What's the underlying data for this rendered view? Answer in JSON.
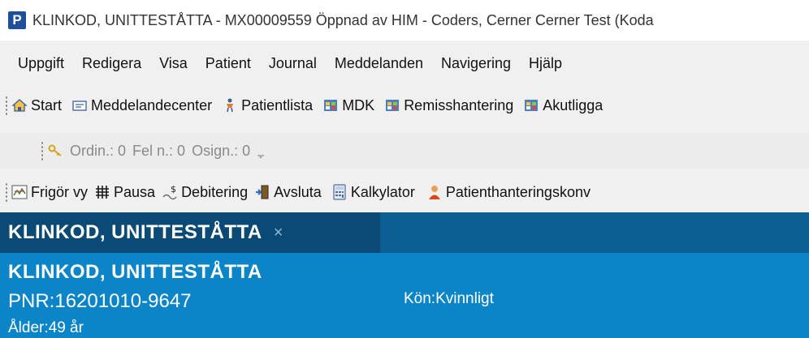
{
  "window": {
    "app_icon_letter": "P",
    "title": "KLINKOD, UNITTESTÅTTA - MX00009559 Öppnad av HIM - Coders, Cerner Cerner Test (Koda"
  },
  "menu": [
    "Uppgift",
    "Redigera",
    "Visa",
    "Patient",
    "Journal",
    "Meddelanden",
    "Navigering",
    "Hjälp"
  ],
  "toolbar1": {
    "items": [
      {
        "label": "Start",
        "icon": "home-icon"
      },
      {
        "label": "Meddelandecenter",
        "icon": "message-center-icon"
      },
      {
        "label": "Patientlista",
        "icon": "patient-list-icon"
      },
      {
        "label": "MDK",
        "icon": "grid-app-icon"
      },
      {
        "label": "Remisshantering",
        "icon": "grid-app-icon"
      },
      {
        "label": "Akutligga",
        "icon": "grid-app-icon"
      }
    ]
  },
  "toolbar2": {
    "ordin": "Ordin.: 0",
    "fel": "Fel n.: 0",
    "osign": "Osign.: 0"
  },
  "toolbar3": {
    "items": [
      {
        "label": "Frigör vy",
        "icon": "release-view-icon"
      },
      {
        "label": "Pausa",
        "icon": "pause-grid-icon"
      },
      {
        "label": "Debitering",
        "icon": "billing-icon"
      },
      {
        "label": "Avsluta",
        "icon": "exit-door-icon"
      },
      {
        "label": "Kalkylator",
        "icon": "calculator-icon"
      },
      {
        "label": "Patienthanteringskonv",
        "icon": "patient-handling-icon"
      }
    ]
  },
  "tab": {
    "label": "KLINKOD, UNITTESTÅTTA",
    "close": "×"
  },
  "banner": {
    "name": "KLINKOD, UNITTESTÅTTA",
    "pnr": "PNR:16201010-9647",
    "sex": "Kön:Kvinnligt",
    "age": "Ålder:49 år"
  },
  "colors": {
    "tab_bar": "#0b5e92",
    "active_tab": "#0a4a75",
    "banner": "#0b84c8"
  }
}
